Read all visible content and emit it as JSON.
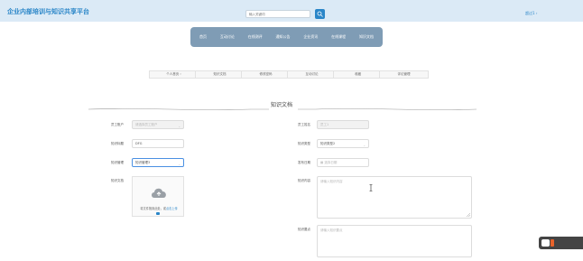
{
  "header": {
    "title": "企业内部培训与知识共享平台",
    "search_placeholder": "输入关键词",
    "user_menu": "超过1 ›"
  },
  "nav": {
    "items": [
      "首页",
      "互动讨论",
      "在线测评",
      "通知公告",
      "企业资讯",
      "在线课程",
      "知识文档"
    ]
  },
  "subnav": {
    "items": [
      "个人首页 ›",
      "知识文档",
      "修改密码",
      "互动讨论",
      "收藏",
      "评论管理"
    ]
  },
  "form": {
    "title": "知识文档",
    "employee_account": {
      "label": "员工账户",
      "value": "请选择员工账户"
    },
    "employee_name": {
      "label": "员工姓名",
      "value": "员工1"
    },
    "doc_title": {
      "label": "知识标题",
      "value": "DFG"
    },
    "doc_type": {
      "label": "知识类型",
      "value": "知识类型2"
    },
    "doc_manager": {
      "label": "知识管理",
      "value": "知识管理3"
    },
    "publish_date": {
      "label": "发布日期",
      "value": "选择日期"
    },
    "doc_file": {
      "label": "知识文档",
      "upload_text": "将文件拖到此处，或",
      "upload_link": "点击上传"
    },
    "doc_content": {
      "label": "知识内容",
      "placeholder": "请输入知识内容"
    },
    "doc_summary": {
      "label": "知识要点",
      "placeholder": "请输入知识要点"
    }
  },
  "colors": {
    "accent": "#2a86c8",
    "nav_bg": "#7f9cb5",
    "topbar_bg": "#dbeaf6"
  },
  "icons": [
    "search-icon",
    "cloud-upload-icon",
    "calendar-icon",
    "chevron-down-icon",
    "text-cursor-icon",
    "resize-handle-icon"
  ]
}
